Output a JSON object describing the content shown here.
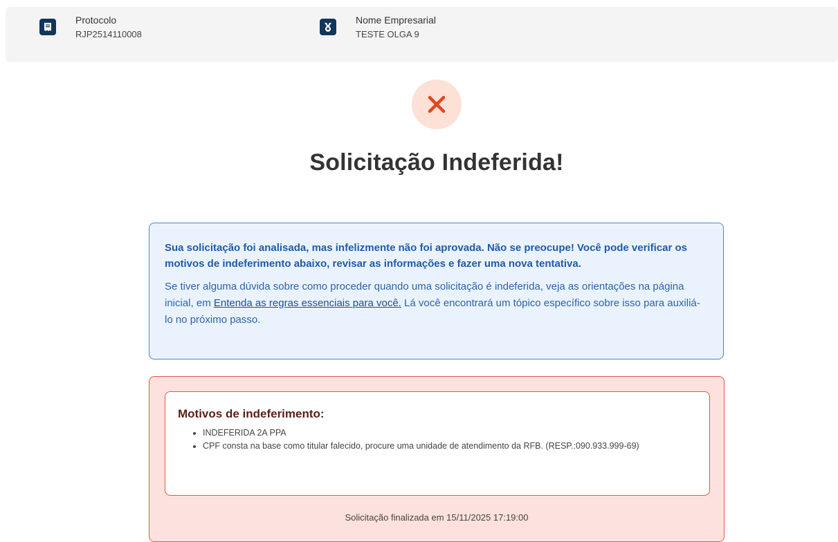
{
  "header": {
    "protocolo": {
      "label": "Protocolo",
      "value": "RJP2514110008",
      "icon": "document-icon"
    },
    "nome_empresarial": {
      "label": "Nome Empresarial",
      "value": "TESTE OLGA 9",
      "icon": "badge-icon"
    }
  },
  "status": {
    "icon": "close-icon",
    "icon_color": "#e0471e",
    "circle_color": "#fde0d6",
    "title": "Solicitação Indeferida!"
  },
  "info_box": {
    "lead": "Sua solicitação foi analisada, mas infelizmente não foi aprovada. Não se preocupe! Você pode verificar os motivos de indeferimento abaixo, revisar as informações e fazer uma nova tentativa.",
    "body_before": "Se tiver alguma dúvida sobre como proceder quando uma solicitação é indeferida, veja as orientações na página inicial, em ",
    "link_text": "Entenda as regras essenciais para você.",
    "body_after": " Lá você encontrará um tópico específico sobre isso para auxiliá-lo no próximo passo."
  },
  "reasons": {
    "title": "Motivos de indeferimento:",
    "items": [
      "INDEFERIDA 2A PPA",
      "CPF consta na base como titular falecido, procure uma unidade de atendimento da RFB. (RESP.:090.933.999-69)"
    ],
    "finalized": "Solicitação finalizada em 15/11/2025 17:19:00"
  },
  "colors": {
    "brand_navy": "#12355b",
    "info_border": "#4f83c9",
    "info_bg": "#eaf3fd",
    "error_border": "#e0584a",
    "error_bg": "#fde1de"
  }
}
